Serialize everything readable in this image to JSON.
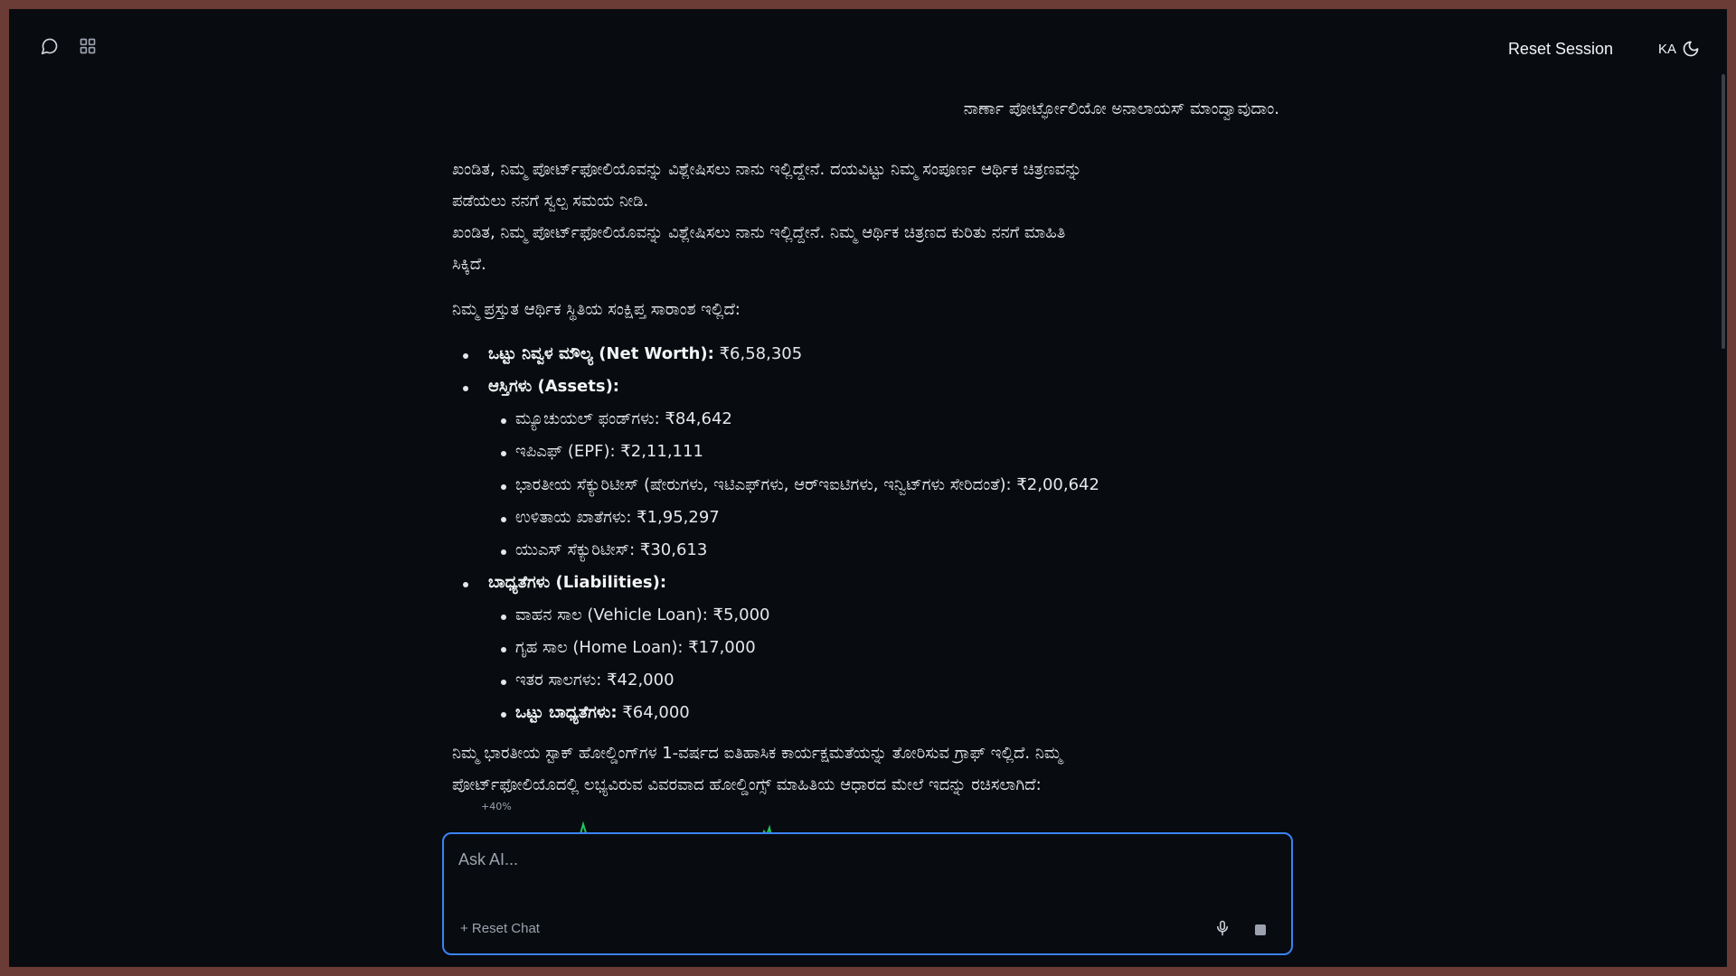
{
  "topbar": {
    "chat_icon": "chat-bubble-icon",
    "grid_icon": "grid-icon",
    "reset_session": "Reset Session",
    "language": "KA",
    "theme_icon": "moon-icon"
  },
  "conversation": {
    "user_message": "ನಾರ್ಣಾ ಪೋರ್ಟ್ಫೋಲಿಯೋ ಅನಾಲಾಯಸ್ ಮಾಂದ್ವಾವುದಾಂ.",
    "para1_line1": "ಖಂಡಿತ, ನಿಮ್ಮ ಪೋರ್ಟ್‌ಫೋಲಿಯೊವನ್ನು ವಿಶ್ಲೇಷಿಸಲು ನಾನು ಇಲ್ಲಿದ್ದೇನೆ. ದಯವಿಟ್ಟು ನಿಮ್ಮ ಸಂಪೂರ್ಣ ಆರ್ಥಿಕ ಚಿತ್ರಣವನ್ನು",
    "para1_line2": "ಪಡೆಯಲು ನನಗೆ ಸ್ವಲ್ಪ ಸಮಯ ನೀಡಿ.",
    "para2_line1": "ಖಂಡಿತ, ನಿಮ್ಮ ಪೋರ್ಟ್‌ಫೋಲಿಯೊವನ್ನು ವಿಶ್ಲೇಷಿಸಲು ನಾನು ಇಲ್ಲಿದ್ದೇನೆ. ನಿಮ್ಮ ಆರ್ಥಿಕ ಚಿತ್ರಣದ ಕುರಿತು ನನಗೆ ಮಾಹಿತಿ",
    "para2_line2": "ಸಿಕ್ಕಿದೆ.",
    "summary_intro": "ನಿಮ್ಮ ಪ್ರಸ್ತುತ ಆರ್ಥಿಕ ಸ್ಥಿತಿಯ ಸಂಕ್ಷಿಪ್ತ ಸಾರಾಂಶ ಇಲ್ಲಿದೆ:",
    "net_worth_label": "ಒಟ್ಟು ನಿವ್ವಳ ಮೌಲ್ಯ (Net Worth):",
    "net_worth_value": " ₹6,58,305",
    "assets_label": "ಆಸ್ತಿಗಳು (Assets):",
    "assets": [
      "ಮ್ಯೂಚುಯಲ್ ಫಂಡ್‌ಗಳು: ₹84,642",
      "ಇಪಿಎಫ್ (EPF): ₹2,11,111",
      "ಭಾರತೀಯ ಸೆಕ್ಯುರಿಟೀಸ್ (ಷೇರುಗಳು, ಇಟಿಎಫ್‌ಗಳು, ಆರ್‌ಇಐಟಿಗಳು, ಇನ್ವಿಟ್‌ಗಳು ಸೇರಿದಂತೆ): ₹2,00,642",
      "ಉಳಿತಾಯ ಖಾತೆಗಳು: ₹1,95,297",
      "ಯುಎಸ್ ಸೆಕ್ಯುರಿಟೀಸ್: ₹30,613"
    ],
    "liabilities_label": "ಬಾಧ್ಯತೆಗಳು (Liabilities):",
    "liabilities": [
      "ವಾಹನ ಸಾಲ (Vehicle Loan): ₹5,000",
      "ಗೃಹ ಸಾಲ (Home Loan): ₹17,000",
      "ಇತರ ಸಾಲಗಳು: ₹42,000"
    ],
    "total_liabilities_label": "ಒಟ್ಟು ಬಾಧ್ಯತೆಗಳು:",
    "total_liabilities_value": " ₹64,000",
    "graph_intro_line1": "ನಿಮ್ಮ ಭಾರತೀಯ ಸ್ಟಾಕ್ ಹೋಲ್ಡಿಂಗ್‌ಗಳ 1-ವರ್ಷದ ಐತಿಹಾಸಿಕ ಕಾರ್ಯಕ್ಷಮತೆಯನ್ನು ತೋರಿಸುವ ಗ್ರಾಫ್ ಇಲ್ಲಿದೆ. ನಿಮ್ಮ",
    "graph_intro_line2": "ಪೋರ್ಟ್‌ಫೋಲಿಯೊದಲ್ಲಿ ಲಭ್ಯವಿರುವ ವಿವರವಾದ ಹೋಲ್ಡಿಂಗ್ಸ್ ಮಾಹಿತಿಯ ಆಧಾರದ ಮೇಲೆ ಇದನ್ನು ರಚಿಸಲಾಗಿದೆ:",
    "chart_tick": "+40%"
  },
  "composer": {
    "placeholder": "Ask AI...",
    "reset_chat": "+ Reset Chat",
    "mic_icon": "microphone-icon",
    "stop_icon": "stop-icon"
  },
  "colors": {
    "background": "#080c10",
    "accent": "#3b82f6",
    "chart_line": "#22c55e"
  }
}
